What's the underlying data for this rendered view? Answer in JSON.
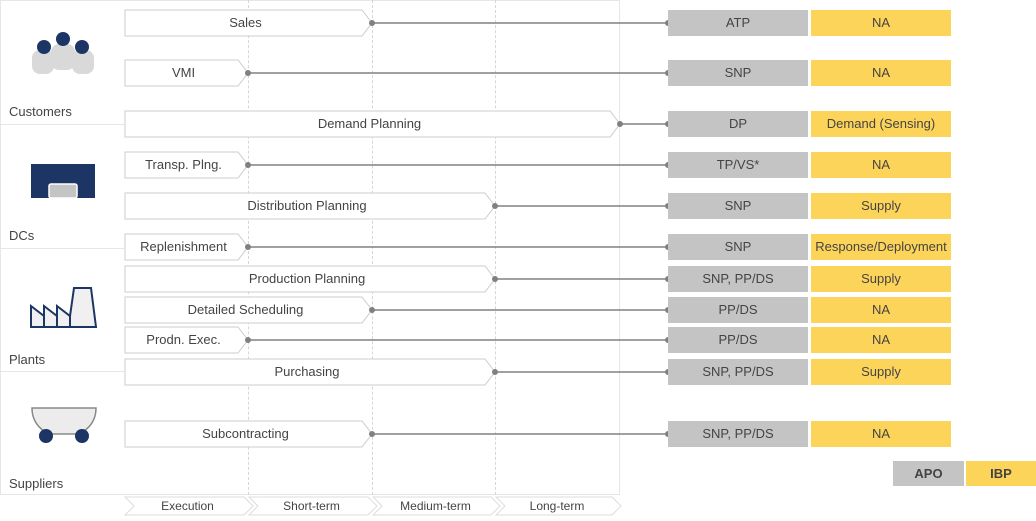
{
  "segments": [
    {
      "name": "Customers",
      "icon": "customers-icon"
    },
    {
      "name": "DCs",
      "icon": "warehouse-icon"
    },
    {
      "name": "Plants",
      "icon": "factory-icon"
    },
    {
      "name": "Suppliers",
      "icon": "cart-icon"
    }
  ],
  "horizons": [
    "Execution",
    "Short-term",
    "Medium-term",
    "Long-term"
  ],
  "processes": [
    {
      "label": "Sales",
      "horizon_end": "Short-term",
      "apo": "ATP",
      "ibp": "NA"
    },
    {
      "label": "VMI",
      "horizon_end": "Execution",
      "apo": "SNP",
      "ibp": "NA"
    },
    {
      "label": "Demand Planning",
      "horizon_end": "Long-term",
      "apo": "DP",
      "ibp": "Demand (Sensing)"
    },
    {
      "label": "Transp. Plng.",
      "horizon_end": "Execution",
      "apo": "TP/VS*",
      "ibp": "NA"
    },
    {
      "label": "Distribution Planning",
      "horizon_end": "Medium-term",
      "apo": "SNP",
      "ibp": "Supply"
    },
    {
      "label": "Replenishment",
      "horizon_end": "Execution",
      "apo": "SNP",
      "ibp": "Response/Deployment"
    },
    {
      "label": "Production Planning",
      "horizon_end": "Medium-term",
      "apo": "SNP, PP/DS",
      "ibp": "Supply"
    },
    {
      "label": "Detailed Scheduling",
      "horizon_end": "Short-term",
      "apo": "PP/DS",
      "ibp": "NA"
    },
    {
      "label": "Prodn. Exec.",
      "horizon_end": "Execution",
      "apo": "PP/DS",
      "ibp": "NA"
    },
    {
      "label": "Purchasing",
      "horizon_end": "Medium-term",
      "apo": "SNP, PP/DS",
      "ibp": "Supply"
    },
    {
      "label": "Subcontracting",
      "horizon_end": "Short-term",
      "apo": "SNP, PP/DS",
      "ibp": "NA"
    }
  ],
  "legend": {
    "apo": "APO",
    "ibp": "IBP"
  },
  "colors": {
    "apo": "#c4c4c4",
    "ibp": "#fdd45a",
    "icon_navy": "#1c3564",
    "icon_grey": "#d9d9d9",
    "connector": "#808080"
  }
}
